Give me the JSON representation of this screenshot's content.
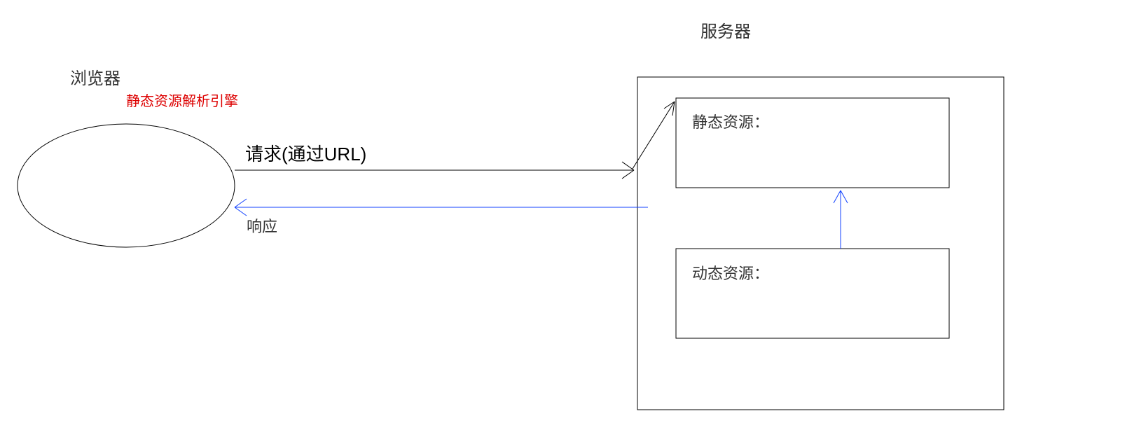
{
  "browser_title": "浏览器",
  "engine_label": "静态资源解析引擎",
  "server_title": "服务器",
  "request_label": "请求(通过URL)",
  "response_label": "响应",
  "static_box_label": "静态资源：",
  "dynamic_box_label": "动态资源："
}
